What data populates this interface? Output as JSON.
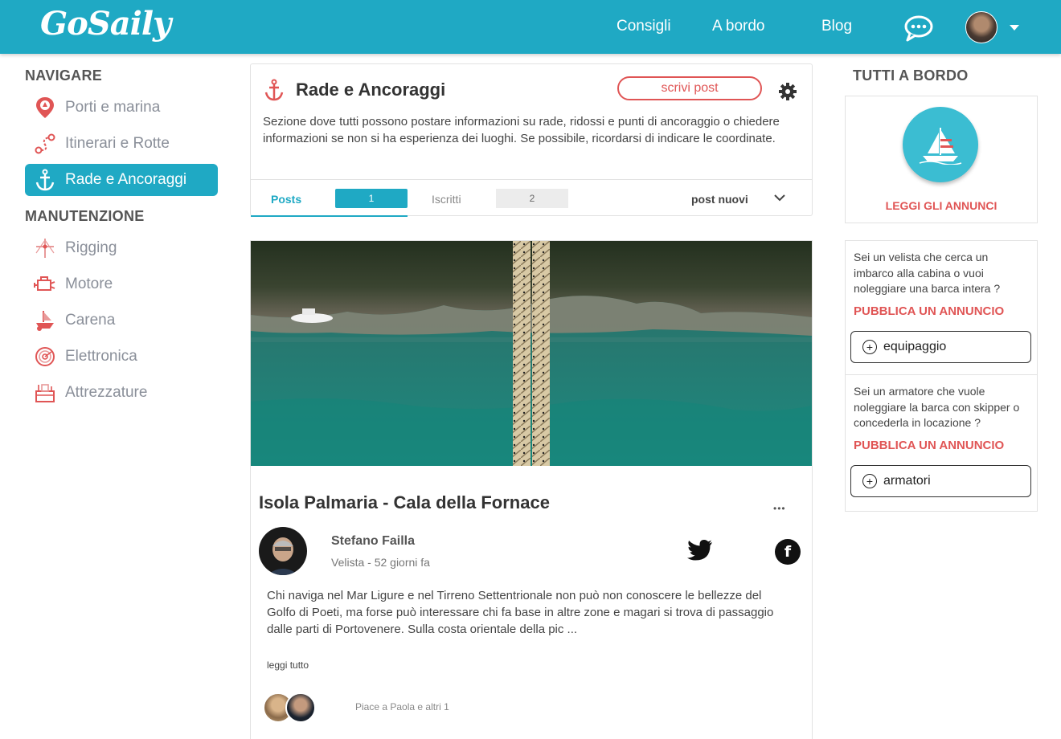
{
  "header": {
    "logo": "GoSaily",
    "nav": [
      "Consigli",
      "A bordo",
      "Blog"
    ]
  },
  "sidebar": {
    "section1": "NAVIGARE",
    "items1": [
      {
        "label": "Porti e marina",
        "icon": "map-pin-icon"
      },
      {
        "label": "Itinerari e Rotte",
        "icon": "route-icon"
      },
      {
        "label": "Rade e Ancoraggi",
        "icon": "anchor-icon",
        "active": true
      }
    ],
    "section2": "MANUTENZIONE",
    "items2": [
      {
        "label": "Rigging",
        "icon": "rigging-icon"
      },
      {
        "label": "Motore",
        "icon": "engine-icon"
      },
      {
        "label": "Carena",
        "icon": "hull-icon"
      },
      {
        "label": "Elettronica",
        "icon": "electronics-icon"
      },
      {
        "label": "Attrezzature",
        "icon": "equipment-icon"
      }
    ]
  },
  "forum": {
    "title": "Rade e Ancoraggi",
    "write_button": "scrivi post",
    "description": "Sezione dove tutti possono postare informazioni su rade, ridossi e punti di ancoraggio o chiedere informazioni se non si ha esperienza dei luoghi. Se possibile, ricordarsi di indicare le coordinate.",
    "tabs": {
      "posts_label": "Posts",
      "posts_count": "1",
      "members_label": "Iscritti",
      "members_count": "2"
    },
    "sort": "post nuovi"
  },
  "post": {
    "title": "Isola Palmaria - Cala della Fornace",
    "author": "Stefano Failla",
    "meta": "Velista - 52 giorni fa",
    "body": "Chi naviga nel Mar Ligure e nel Tirreno Settentrionale non può non conoscere le bellezze del Golfo di Poeti, ma forse può interessare chi fa base in altre zone e magari si trova di passaggio dalle parti di Portovenere. Sulla costa orientale della pic ...",
    "read_more": "leggi tutto",
    "likes": "Piace a Paola e altri 1",
    "menu": "•••"
  },
  "right": {
    "heading": "TUTTI A BORDO",
    "leggi": "LEGGI GLI ANNUNCI",
    "text1": "Sei un velista che cerca un imbarco alla cabina o vuoi noleggiare una barca intera ?",
    "pubblica1": "PUBBLICA UN ANNUNCIO",
    "button1": "equipaggio",
    "text2": "Sei un armatore che vuole noleggiare la barca con skipper o concederla in locazione ?",
    "pubblica2": "PUBBLICA UN ANNUNCIO",
    "button2": "armatori"
  },
  "colors": {
    "brand": "#1fa9c4",
    "accent": "#e05555"
  }
}
